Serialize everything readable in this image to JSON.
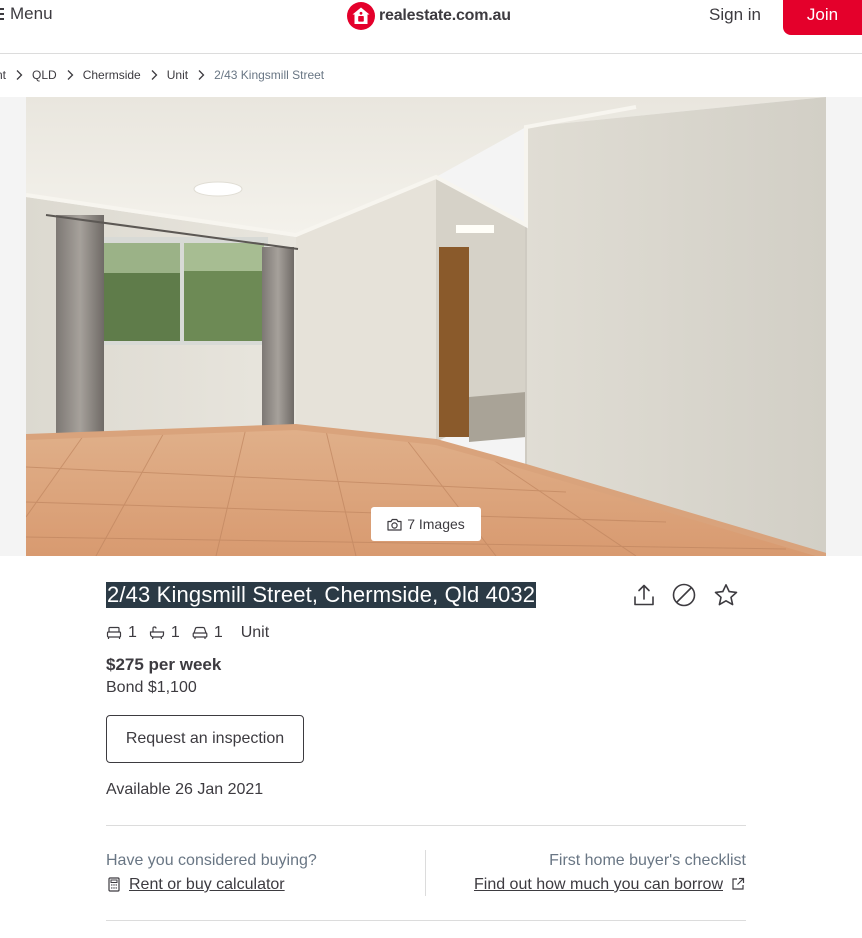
{
  "header": {
    "menu_label": "Menu",
    "logo_text": "realestate.com.au",
    "sign_in": "Sign in",
    "join": "Join",
    "brand_color": "#e4002b"
  },
  "breadcrumb": [
    {
      "label": "nt"
    },
    {
      "label": "QLD"
    },
    {
      "label": "Chermside"
    },
    {
      "label": "Unit"
    },
    {
      "label": "2/43 Kingsmill Street"
    }
  ],
  "gallery": {
    "images_label": "7 Images",
    "icon": "camera-icon"
  },
  "listing": {
    "address": "2/43 Kingsmill Street, Chermside, Qld 4032",
    "actions": [
      "share-icon",
      "hide-icon",
      "star-icon"
    ],
    "bedrooms": "1",
    "bathrooms": "1",
    "car_spaces": "1",
    "property_type": "Unit",
    "price": "$275 per week",
    "bond": "Bond $1,100",
    "inspection_button": "Request an inspection",
    "available": "Available 26 Jan 2021"
  },
  "footer_links": {
    "question": "Have you considered buying?",
    "calculator_link": "Rent or buy calculator",
    "checklist": "First home buyer's checklist",
    "borrow_link": "Find out how much you can borrow"
  }
}
